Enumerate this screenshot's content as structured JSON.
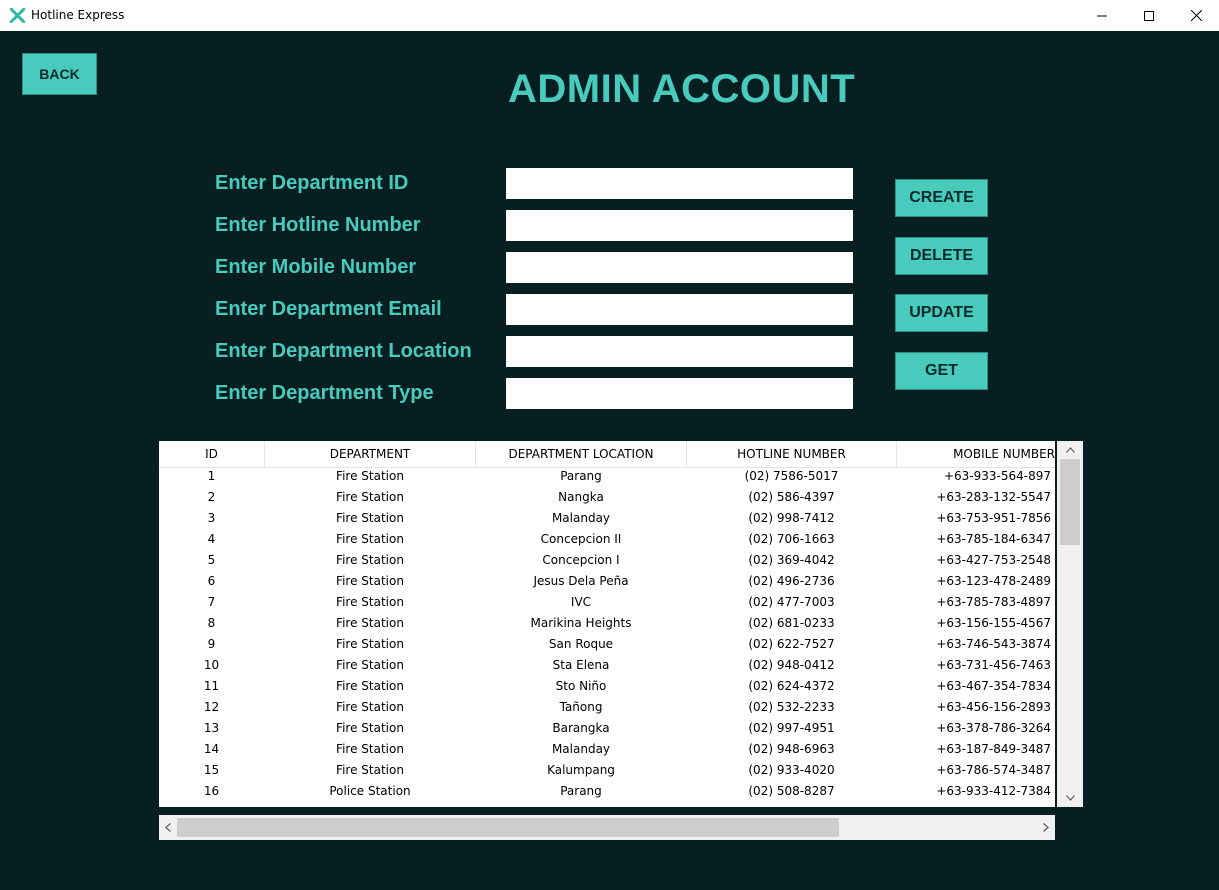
{
  "window": {
    "title": "Hotline Express",
    "minimize_glyph": "—",
    "maximize_glyph": "☐",
    "close_glyph": "✕"
  },
  "colors": {
    "background": "#081f22",
    "accent": "#48cbbd",
    "button_text": "#0b2a2c"
  },
  "page": {
    "title": "ADMIN ACCOUNT",
    "back_label": "BACK"
  },
  "form": {
    "fields": [
      {
        "label": "Enter Department ID",
        "value": ""
      },
      {
        "label": "Enter Hotline Number",
        "value": ""
      },
      {
        "label": "Enter Mobile Number",
        "value": ""
      },
      {
        "label": "Enter Department Email",
        "value": ""
      },
      {
        "label": "Enter Department Location",
        "value": ""
      },
      {
        "label": "Enter Department Type",
        "value": ""
      }
    ]
  },
  "actions": {
    "create": "CREATE",
    "delete": "DELETE",
    "update": "UPDATE",
    "get": "GET"
  },
  "table": {
    "columns": [
      "ID",
      "DEPARTMENT",
      "DEPARTMENT LOCATION",
      "HOTLINE NUMBER",
      "MOBILE NUMBER"
    ],
    "rows": [
      [
        "1",
        "Fire Station",
        "Parang",
        "(02) 7586-5017",
        "+63-933-564-897"
      ],
      [
        "2",
        "Fire Station",
        "Nangka",
        "(02) 586-4397",
        "+63-283-132-5547"
      ],
      [
        "3",
        "Fire Station",
        "Malanday",
        "(02) 998-7412",
        "+63-753-951-7856"
      ],
      [
        "4",
        "Fire Station",
        "Concepcion II",
        "(02) 706-1663",
        "+63-785-184-6347"
      ],
      [
        "5",
        "Fire Station",
        "Concepcion I",
        "(02) 369-4042",
        "+63-427-753-2548"
      ],
      [
        "6",
        "Fire Station",
        "Jesus Dela Peña",
        "(02) 496-2736",
        "+63-123-478-2489"
      ],
      [
        "7",
        "Fire Station",
        "IVC",
        "(02) 477-7003",
        "+63-785-783-4897"
      ],
      [
        "8",
        "Fire Station",
        "Marikina Heights",
        "(02) 681-0233",
        "+63-156-155-4567"
      ],
      [
        "9",
        "Fire Station",
        "San Roque",
        "(02) 622-7527",
        "+63-746-543-3874"
      ],
      [
        "10",
        "Fire Station",
        "Sta Elena",
        "(02) 948-0412",
        "+63-731-456-7463"
      ],
      [
        "11",
        "Fire Station",
        "Sto Niño",
        "(02) 624-4372",
        "+63-467-354-7834"
      ],
      [
        "12",
        "Fire Station",
        "Tañong",
        "(02) 532-2233",
        "+63-456-156-2893"
      ],
      [
        "13",
        "Fire Station",
        "Barangka",
        "(02) 997-4951",
        "+63-378-786-3264"
      ],
      [
        "14",
        "Fire Station",
        "Malanday",
        "(02) 948-6963",
        "+63-187-849-3487"
      ],
      [
        "15",
        "Fire Station",
        "Kalumpang",
        "(02) 933-4020",
        "+63-786-574-3487"
      ],
      [
        "16",
        "Police Station",
        "Parang",
        "(02) 508-8287",
        "+63-933-412-7384"
      ]
    ]
  },
  "scrollbars": {
    "up": "▲",
    "down": "▼",
    "left": "◀",
    "right": "▶"
  }
}
